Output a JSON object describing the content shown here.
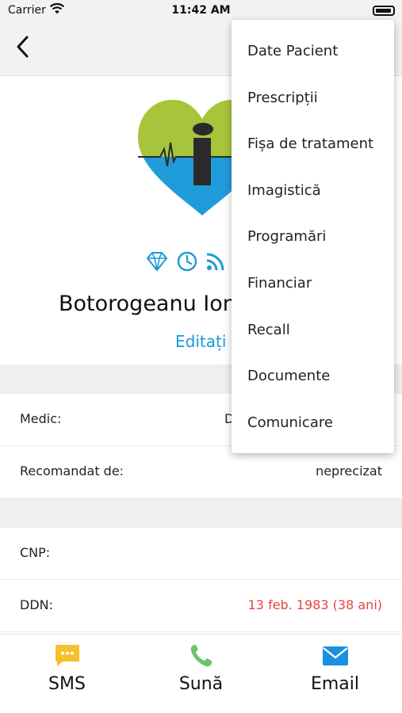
{
  "status_bar": {
    "carrier": "Carrier",
    "time": "11:42 AM"
  },
  "patient": {
    "name": "Botorogeanu Ion",
    "edit_label": "Editați",
    "badges": [
      "diamond-icon",
      "clock-icon",
      "rss-icon"
    ]
  },
  "details": [
    {
      "label": "Medic:",
      "value": "D"
    },
    {
      "label": "Recomandat de:",
      "value": "neprecizat"
    },
    {
      "label": "CNP:",
      "value": ""
    },
    {
      "label": "DDN:",
      "value": "13 feb. 1983 (38 ani)"
    }
  ],
  "tab_bar": [
    {
      "label": "SMS",
      "icon": "sms-icon"
    },
    {
      "label": "Sună",
      "icon": "phone-icon"
    },
    {
      "label": "Email",
      "icon": "email-icon"
    }
  ],
  "menu": [
    "Date Pacient",
    "Prescripții",
    "Fișa de tratament",
    "Imagistică",
    "Programări",
    "Financiar",
    "Recall",
    "Documente",
    "Comunicare"
  ],
  "colors": {
    "accent": "#1a9ad6",
    "logo_green": "#a7c43a",
    "logo_blue": "#1f9bd9",
    "sms_yellow": "#f5c02b",
    "phone_green": "#6cc36b",
    "email_blue": "#1b8fe0",
    "age_red": "#e2453c"
  }
}
